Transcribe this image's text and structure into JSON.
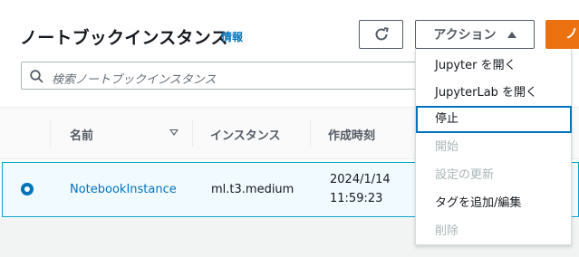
{
  "header": {
    "title": "ノートブックインスタンス",
    "info_link": "情報",
    "actions_label": "アクション",
    "primary_label": "ノ"
  },
  "search": {
    "placeholder": "検索ノートブックインスタンス"
  },
  "table": {
    "columns": [
      "名前",
      "インスタンス",
      "作成時刻"
    ],
    "rows": [
      {
        "name": "NotebookInstance",
        "instance": "ml.t3.medium",
        "created_date": "2024/1/14",
        "created_time": "11:59:23",
        "selected": true
      }
    ]
  },
  "menu": {
    "items": [
      {
        "label": "Jupyter を開く",
        "enabled": true
      },
      {
        "label": "JupyterLab を開く",
        "enabled": true
      },
      {
        "label": "停止",
        "enabled": true,
        "highlighted": true
      },
      {
        "label": "開始",
        "enabled": false
      },
      {
        "label": "設定の更新",
        "enabled": false
      },
      {
        "label": "タグを追加/編集",
        "enabled": true
      },
      {
        "label": "削除",
        "enabled": false
      }
    ]
  },
  "colors": {
    "accent": "#0073bb",
    "primary_button": "#ec7211",
    "selected_row_bg": "#f1faff",
    "selected_row_border": "#00a1c9"
  }
}
